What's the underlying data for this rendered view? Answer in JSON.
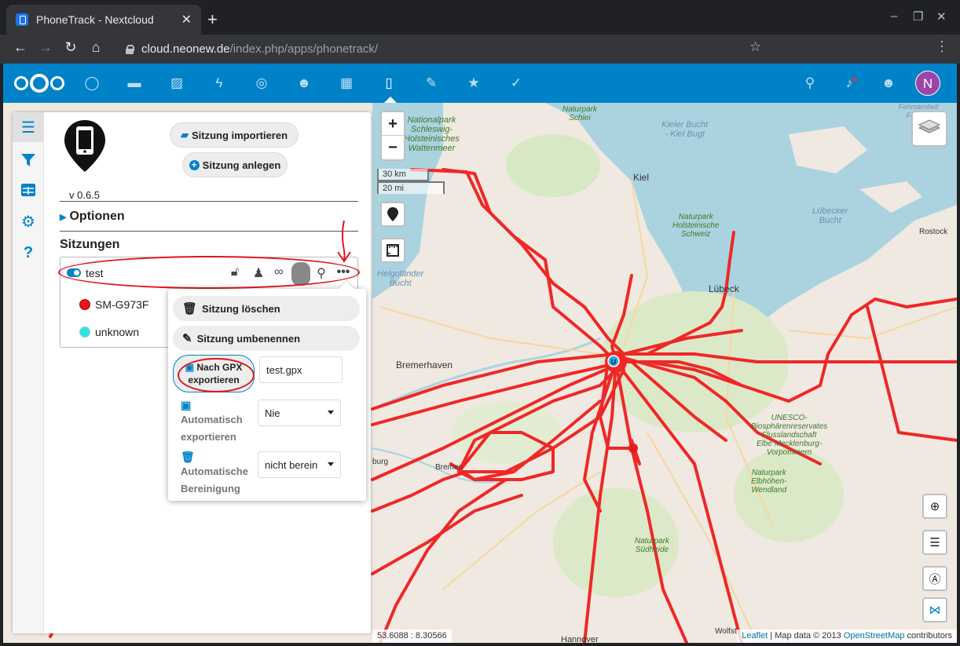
{
  "browser": {
    "tab_title": "PhoneTrack - Nextcloud",
    "tab_close": "✕",
    "new_tab": "+",
    "url_host": "cloud.neonew.de",
    "url_path": "/index.php/apps/phonetrack/",
    "window_controls": [
      "–",
      "❐",
      "✕"
    ]
  },
  "header": {
    "avatar_letter": "N",
    "accent": "#0082c9"
  },
  "sidebar": {
    "import_label": "Sitzung importieren",
    "create_label": "Sitzung anlegen",
    "version": "v 0.6.5",
    "options_label": "Optionen",
    "sessions_label": "Sitzungen",
    "session": {
      "name": "test",
      "devices": [
        {
          "name": "SM-G973F",
          "color": "#e3151d"
        },
        {
          "name": "unknown",
          "color": "#2de3e6"
        }
      ]
    }
  },
  "menu": {
    "delete_label": "Sitzung löschen",
    "rename_label": "Sitzung umbenennen",
    "export_label_1": "Nach GPX",
    "export_label_2": "exportieren",
    "export_filename": "test.gpx",
    "autoexport_label_1": "Automatisch",
    "autoexport_label_2": "exportieren",
    "autoexport_value": "Nie",
    "autopurge_label_1": "Automatische",
    "autopurge_label_2": "Bereinigung",
    "autopurge_value": "nicht berein"
  },
  "map": {
    "zoom_in": "+",
    "zoom_out": "−",
    "scale_km": "30 km",
    "scale_mi": "20 mi",
    "coords": "53.6088 : 8.30566",
    "attribution_leaflet": "Leaflet",
    "attribution_mid": " | Map data © 2013 ",
    "attribution_osm": "OpenStreetMap",
    "attribution_end": " contributors",
    "marker_letter": "U",
    "labels": {
      "kiel": "Kiel",
      "lubeck": "Lübeck",
      "bremerhaven": "Bremerhaven",
      "rostock": "Rostock",
      "wolfst": "Wolfst",
      "bremen": "Bremen",
      "burg": "burg",
      "hannover": "Hannover",
      "kieler_bucht": "Kieler Bucht\n- Kiel Bugt",
      "lubecker_bucht": "Lübecker\nBucht",
      "helgolander_bucht": "Helgoländer\nBucht",
      "fehmarnbelt": "Fehmarnbelt\nFemern\nBælt",
      "np_schlei": "Naturpark\nSchlei",
      "np_wattenmeer": "Nationalpark\nSchleswig-\nHolsteinisches\nWattenmeer",
      "np_holstein": "Naturpark\nHolsteinische\nSchweiz",
      "unesco": "UNESCO-\nBiosphärenreservates\nFlusslandschaft\nElbe Mecklenburg-\nVorpommern",
      "np_elbhoehen": "Naturpark\nElbhöhen-\nWendland",
      "np_suedheide": "Naturpark\nSüdheide"
    }
  },
  "colors": {
    "track": "#f02727",
    "water": "#aad3df",
    "land": "#efe9e1"
  }
}
